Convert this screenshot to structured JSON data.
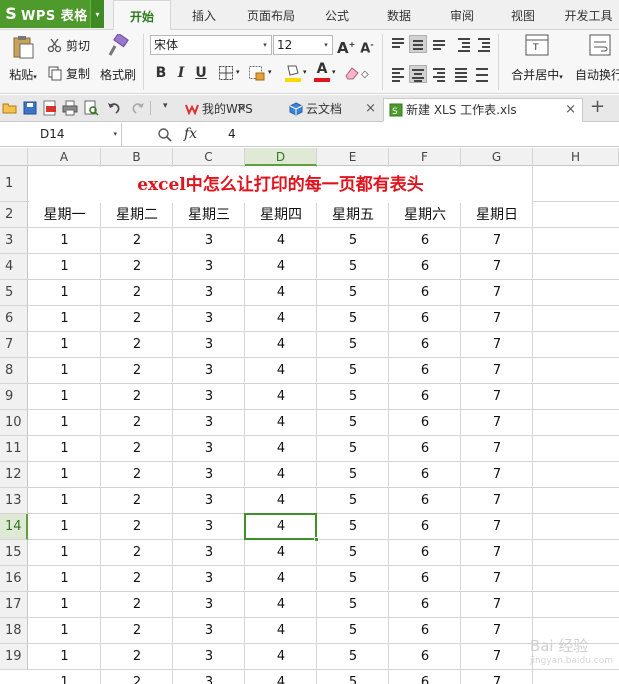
{
  "app": {
    "logo": "S",
    "title": "WPS 表格",
    "menu_arrow": "▾"
  },
  "menu_tabs": [
    {
      "label": "开始",
      "active": true
    },
    {
      "label": "插入",
      "active": false
    },
    {
      "label": "页面布局",
      "active": false
    },
    {
      "label": "公式",
      "active": false
    },
    {
      "label": "数据",
      "active": false
    },
    {
      "label": "审阅",
      "active": false
    },
    {
      "label": "视图",
      "active": false
    },
    {
      "label": "开发工具",
      "active": false
    }
  ],
  "ribbon": {
    "paste_label": "粘贴",
    "cut_label": "剪切",
    "copy_label": "复制",
    "format_painter_label": "格式刷",
    "font_name": "宋体",
    "font_size": "12",
    "bold": "B",
    "italic": "I",
    "underline": "U",
    "merge_center_label": "合并居中",
    "wrap_label": "自动换行",
    "dropdown_glyph": "▾"
  },
  "doc_tabs": [
    {
      "label": "我的WPS",
      "icon": "wps-logo-icon",
      "close": "×",
      "active": false
    },
    {
      "label": "云文档",
      "icon": "cloud-cube-icon",
      "close": "×",
      "active": false
    },
    {
      "label": "新建 XLS 工作表.xls",
      "icon": "spreadsheet-file-icon",
      "close": "×",
      "active": true
    }
  ],
  "new_tab_glyph": "+",
  "formula_bar": {
    "cell_ref": "D14",
    "fx": "fx",
    "value": "4"
  },
  "sheet": {
    "columns": [
      "A",
      "B",
      "C",
      "D",
      "E",
      "F",
      "G",
      "H"
    ],
    "selected_column": "D",
    "selected_row": 14,
    "row_numbers": [
      "1",
      "2",
      "3",
      "4",
      "5",
      "6",
      "7",
      "8",
      "9",
      "10",
      "11",
      "12",
      "13",
      "14",
      "15",
      "16",
      "17",
      "18",
      "19"
    ],
    "title": "excel中怎么让打印的每一页都有表头",
    "headers": [
      "星期一",
      "星期二",
      "星期三",
      "星期四",
      "星期五",
      "星期六",
      "星期日"
    ],
    "row_values": [
      "1",
      "2",
      "3",
      "4",
      "5",
      "6",
      "7"
    ],
    "data_row_count": 17
  },
  "watermark": {
    "text": "Bai 经验",
    "sub": "jingyan.baidu.com"
  },
  "colors": {
    "brand_green": "#4e9a2c",
    "title_red": "#e0141e",
    "selection_green": "#3f8f2a"
  }
}
